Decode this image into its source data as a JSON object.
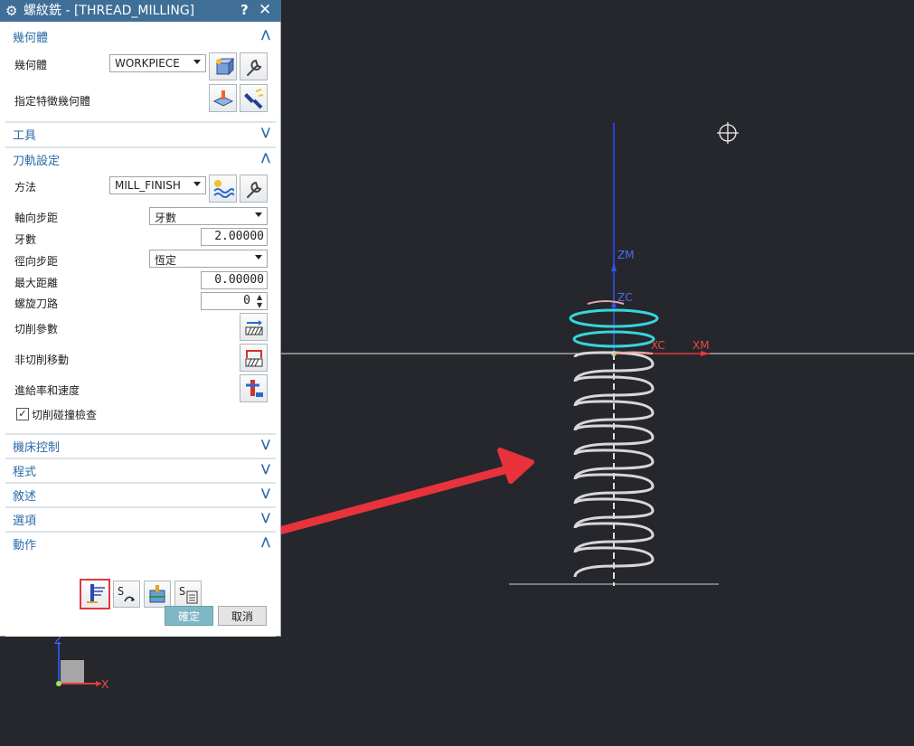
{
  "dialog": {
    "title": "螺紋銑 - [THREAD_MILLING]",
    "help": "?",
    "close": "✕",
    "title_bar_color": "#3f6f97"
  },
  "sections": {
    "geometry": {
      "label": "幾何體",
      "expanded": true
    },
    "tool": {
      "label": "工具",
      "expanded": false
    },
    "path_settings": {
      "label": "刀軌設定",
      "expanded": true
    },
    "machine_control": {
      "label": "機床控制",
      "expanded": false
    },
    "program": {
      "label": "程式",
      "expanded": false
    },
    "description": {
      "label": "敘述",
      "expanded": false
    },
    "options": {
      "label": "選項",
      "expanded": false
    },
    "actions": {
      "label": "動作",
      "expanded": true
    }
  },
  "geometry": {
    "geometry_label": "幾何體",
    "geometry_value": "WORKPIECE",
    "feature_label": "指定特徵幾何體"
  },
  "path": {
    "method_label": "方法",
    "method_value": "MILL_FINISH",
    "axial_step_label": "軸向步距",
    "axial_step_value": "牙數",
    "threads_label": "牙數",
    "threads_value": "2.00000",
    "radial_step_label": "徑向步距",
    "radial_step_value": "恆定",
    "max_dist_label": "最大距離",
    "max_dist_value": "0.00000",
    "spiral_label": "螺旋刀路",
    "spiral_value": "0",
    "cut_params_label": "切削參數",
    "non_cut_label": "非切削移動",
    "feeds_label": "進給率和速度",
    "collision_label": "切削碰撞檢查",
    "collision_checked": true
  },
  "buttons": {
    "ok": "確定",
    "cancel": "取消"
  },
  "viewport": {
    "axis_labels": {
      "zm": "ZM",
      "zc": "ZC",
      "xc": "XC",
      "xm": "XM"
    },
    "triad_labels": {
      "z": "Z",
      "x": "X"
    },
    "background": "#25272c",
    "helix_color": "#d8d8d8",
    "highlight_color": "#39d4dc",
    "arrow_color": "#e8323c"
  }
}
